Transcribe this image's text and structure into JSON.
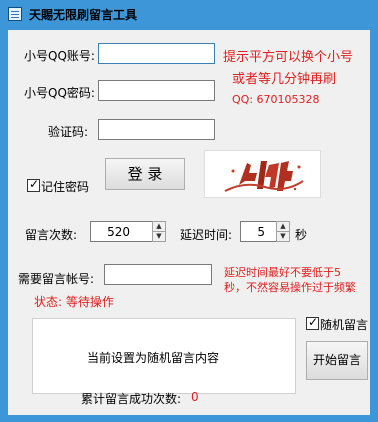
{
  "title": "天賜无限刷留言工具",
  "form": {
    "qq_account_label": "小号QQ账号:",
    "qq_password_label": "小号QQ密码:",
    "captcha_label": "验证码:",
    "qq_account_value": "",
    "qq_password_value": "",
    "captcha_value": "",
    "remember_label": "记住密码",
    "remember_checked": true,
    "login_button": "登 录"
  },
  "tips": {
    "line1": "提示平方可以换个小号",
    "line2": "或者等几分钟再刷",
    "qq": "QQ: 670105328"
  },
  "settings": {
    "count_label": "留言次数:",
    "count_value": "520",
    "delay_label": "延迟时间:",
    "delay_value": "5",
    "delay_unit": "秒",
    "target_label": "需要留言帐号:",
    "target_value": "",
    "delay_warning_line1": "延迟时间最好不要低于5",
    "delay_warning_line2": "秒，不然容易操作过于频繁"
  },
  "status": {
    "text": "状态: 等待操作"
  },
  "message": {
    "content": "当前设置为随机留言内容",
    "random_label": "随机留言",
    "random_checked": true,
    "start_button": "开始留言"
  },
  "footer": {
    "success_label": "累计留言成功次数:",
    "success_count": "0"
  },
  "colors": {
    "titlebar": "#3d96d8",
    "warning_text": "#e02020",
    "captcha_ink": "#b03020"
  }
}
